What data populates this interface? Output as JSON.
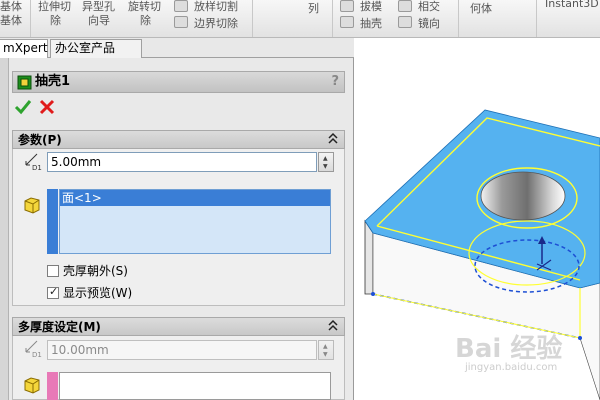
{
  "ribbon": {
    "items": [
      {
        "label": "基体",
        "name": "ribbon-base"
      },
      {
        "label": "拉伸切",
        "name": "ribbon-extrude-cut-top"
      },
      {
        "label": "除",
        "name": "ribbon-extrude-cut-bottom"
      },
      {
        "label": "异型孔",
        "name": "ribbon-hole-wizard-top"
      },
      {
        "label": "向导",
        "name": "ribbon-hole-wizard-bottom"
      },
      {
        "label": "旋转切",
        "name": "ribbon-revolve-cut-top"
      },
      {
        "label": "除",
        "name": "ribbon-revolve-cut-bottom"
      },
      {
        "label": "放样切割",
        "name": "ribbon-loft-cut"
      },
      {
        "label": "边界切除",
        "name": "ribbon-boundary-cut"
      },
      {
        "label": "列",
        "name": "ribbon-pattern"
      },
      {
        "label": "拔模",
        "name": "ribbon-draft"
      },
      {
        "label": "抽壳",
        "name": "ribbon-shell"
      },
      {
        "label": "相交",
        "name": "ribbon-intersect"
      },
      {
        "label": "镜向",
        "name": "ribbon-mirror"
      },
      {
        "label": "何体",
        "name": "ribbon-geometry"
      },
      {
        "label": "Instant3D",
        "name": "ribbon-instant3d"
      }
    ]
  },
  "tabs": [
    {
      "label": "mXpert",
      "active": true
    },
    {
      "label": "办公室产品",
      "active": false
    }
  ],
  "property_manager": {
    "title": "抽壳1",
    "help": "?",
    "parameters": {
      "title": "参数(P)",
      "thickness": "5.00mm",
      "faces_to_remove": [
        "面<1>"
      ],
      "shell_outward_label": "壳厚朝外(S)",
      "shell_outward_checked": false,
      "show_preview_label": "显示预览(W)",
      "show_preview_checked": true
    },
    "multi_thickness": {
      "title": "多厚度设定(M)",
      "thickness": "10.00mm"
    }
  },
  "watermark": {
    "text": "Bai 经验",
    "sub": "jingyan.baidu.com"
  },
  "colors": {
    "selected_face": "#55b2f0",
    "edge_highlight": "#ffff33",
    "list_selection": "#3a7ed6",
    "cancel_red": "#e01b1b",
    "ok_green": "#2ea32e"
  }
}
